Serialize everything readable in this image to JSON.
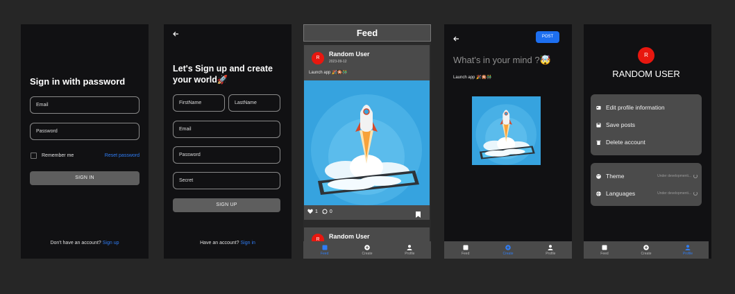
{
  "signin": {
    "title": "Sign in with password",
    "email_placeholder": "Email",
    "password_placeholder": "Password",
    "remember_label": "Remember me",
    "reset_link": "Reset password",
    "signin_button": "SIGN IN",
    "footer_text": "Don't have an account?",
    "footer_link": "Sign up"
  },
  "signup": {
    "title": "Let's Sign up and create your world🚀",
    "firstname_placeholder": "FirstName",
    "lastname_placeholder": "LastName",
    "email_placeholder": "Email",
    "password_placeholder": "Password",
    "secret_placeholder": "Secret",
    "signup_button": "SIGN UP",
    "footer_text": "Have an account?",
    "footer_link": "Sign in"
  },
  "feed": {
    "header": "Feed",
    "post1": {
      "avatar_letter": "R",
      "user": "Random User",
      "date": "2023-09-12",
      "caption": "Launch app 🎉🎇👬",
      "likes": "1",
      "comments": "0"
    },
    "post2": {
      "avatar_letter": "R",
      "user": "Random User"
    },
    "nav": [
      "Feed",
      "Create",
      "Profile"
    ]
  },
  "create": {
    "post_button": "POST",
    "prompt": "What's in your mind ?🤯",
    "caption": "Launch app 🎉🎇👬",
    "nav": [
      "Feed",
      "Create",
      "Profile"
    ]
  },
  "profile": {
    "avatar_letter": "R",
    "username": "RANDOM USER",
    "menu1": [
      "Edit profile information",
      "Save posts",
      "Delete account"
    ],
    "menu2": [
      "Theme",
      "Languages"
    ],
    "dev_text": "Under developmenti...",
    "nav": [
      "Feed",
      "Create",
      "Profile"
    ]
  },
  "colors": {
    "accent": "#2f7df6",
    "avatar": "#e8170f",
    "panel": "#4b4b4b",
    "screen": "#111113",
    "background": "#262626"
  }
}
